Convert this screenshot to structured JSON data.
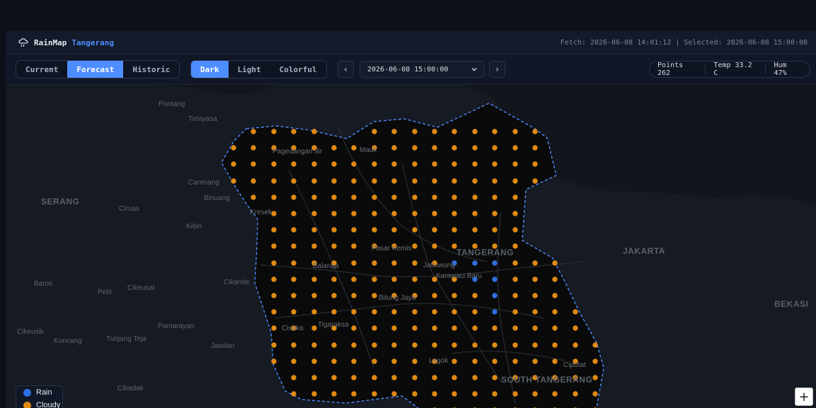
{
  "header": {
    "app_name": "RainMap",
    "city": "Tangerang",
    "fetch_text": "Fetch: 2026-06-08 14:01:12 | Selected: 2026-06-08 15:00:00"
  },
  "mode_tabs": [
    {
      "label": "Current",
      "active": false
    },
    {
      "label": "Forecast",
      "active": true
    },
    {
      "label": "Historic",
      "active": false
    }
  ],
  "theme_tabs": [
    {
      "label": "Dark",
      "active": true
    },
    {
      "label": "Light",
      "active": false
    },
    {
      "label": "Colorful",
      "active": false
    }
  ],
  "time_select": {
    "prev_label": "‹",
    "next_label": "›",
    "value": "2026-06-08 15:00:00"
  },
  "stats": {
    "points": "Points 262",
    "temp": "Temp 33.2 C",
    "hum": "Hum 47%"
  },
  "colors": {
    "accent": "#4d8dff",
    "cloudy_dot": "#e08a14",
    "rain_dot": "#2f6fe0",
    "boundary": "#4d8dff"
  },
  "map": {
    "places": {
      "pontang": "Pontang",
      "tirtayasa": "Tirtayasa",
      "serang": "SERANG",
      "ciruas": "Ciruas",
      "carenang": "Carenang",
      "binuang": "Binuang",
      "kibin": "Kibin",
      "pagedangan_ilir": "Pagedangan Ilir",
      "mauk": "Mauk",
      "kresek": "Kresek",
      "pasar_kemis": "Pasar Kemis",
      "tangerang": "TANGERANG",
      "jakarta": "JAKARTA",
      "jatiuwung": "Jatiuwung",
      "karawaci_baru": "Karawaci Baru",
      "balaraja": "Balaraja",
      "cikande": "Cikande",
      "baros": "Baros",
      "petir": "Petir",
      "cikeusal": "Cikeusal",
      "bitung_jaya": "Bitung Jaya",
      "bekasi": "BEKASI",
      "cisoka": "Cisoka",
      "tigaraksa": "Tigaraksa",
      "pamarayan": "Pamarayan",
      "cikeusik": "Cikeusik",
      "koncang": "Koncang",
      "tunjung_teja": "Tunjung Teja",
      "jawilan": "Jawilan",
      "legok": "Legok",
      "ciputat": "Ciputat",
      "south_tangerang": "SOUTH TANGERANG",
      "cibadak": "Cibadak"
    }
  },
  "legend": {
    "rain_label": "Rain",
    "cloudy_label": "Cloudy"
  },
  "zoom_in_label": "+"
}
